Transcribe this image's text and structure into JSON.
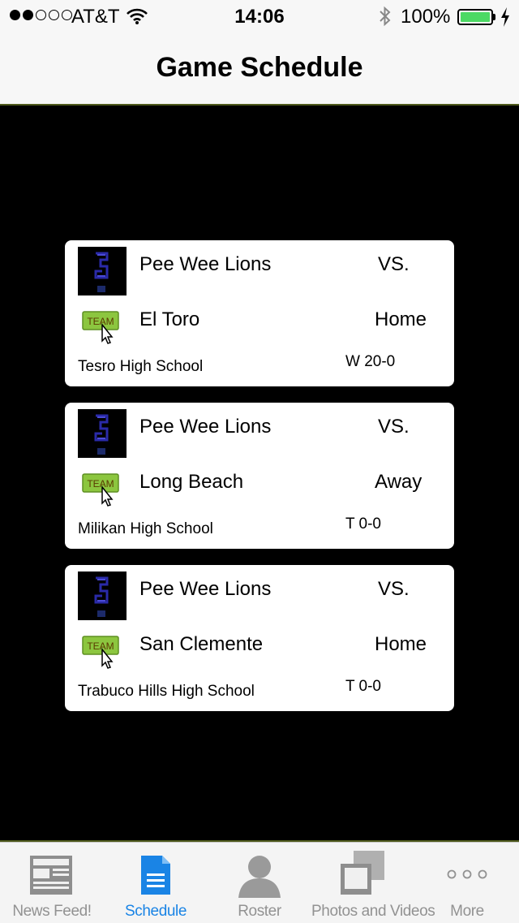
{
  "status_bar": {
    "carrier": "AT&T",
    "time": "14:06",
    "battery": "100%",
    "signal_bars": 2
  },
  "nav": {
    "title": "Game Schedule"
  },
  "games": [
    {
      "team": "Pee Wee Lions",
      "vs": "VS.",
      "opponent": "El Toro",
      "home_away": "Home",
      "venue": "Tesro High School",
      "result": "W 20-0",
      "badge_text": "TEAM"
    },
    {
      "team": "Pee Wee Lions",
      "vs": "VS.",
      "opponent": "Long Beach",
      "home_away": "Away",
      "venue": "Milikan High School",
      "result": "T 0-0",
      "badge_text": "TEAM"
    },
    {
      "team": "Pee Wee Lions",
      "vs": "VS.",
      "opponent": "San Clemente",
      "home_away": "Home",
      "venue": "Trabuco Hills High School",
      "result": "T 0-0",
      "badge_text": "TEAM"
    }
  ],
  "tab_bar": {
    "items": [
      {
        "label": "News Feed!",
        "icon": "newspaper-icon"
      },
      {
        "label": "Schedule",
        "icon": "document-icon",
        "active": true
      },
      {
        "label": "Roster",
        "icon": "person-icon"
      },
      {
        "label": "Photos and Videos",
        "icon": "photos-icon"
      },
      {
        "label": "More",
        "icon": "more-icon"
      }
    ]
  },
  "colors": {
    "accent": "#1a84e5",
    "battery": "#4cd964",
    "badge_green": "#8cc63f"
  }
}
